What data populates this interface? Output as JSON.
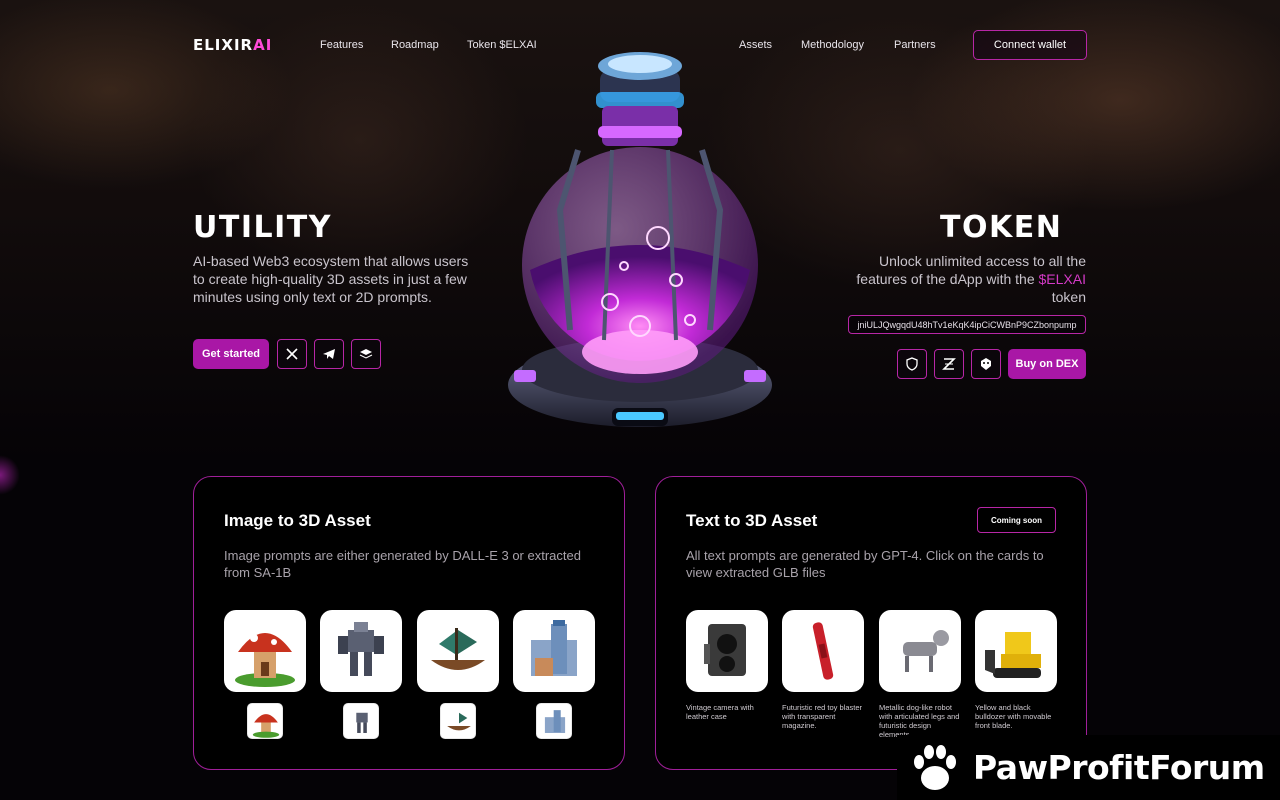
{
  "nav": {
    "logo_text": "ELIXIR",
    "logo_accent": "AI",
    "links_left": [
      "Features",
      "Roadmap",
      "Token $ELXAI"
    ],
    "links_right": [
      "Assets",
      "Methodology",
      "Partners"
    ],
    "connect_wallet": "Connect wallet"
  },
  "hero_left": {
    "title": "UTILITY",
    "description": "AI-based Web3 ecosystem that allows users to create high-quality 3D assets in just a few minutes using only text or 2D prompts.",
    "get_started": "Get started",
    "social_icons": [
      "x-icon",
      "telegram-icon",
      "docs-icon"
    ]
  },
  "hero_right": {
    "title": "TOKEN",
    "desc_before": "Unlock unlimited access to all the features of the dApp with the ",
    "desc_token": "$ELXAI",
    "desc_after": " token",
    "contract_address": "jniULJQwgqdU48hTv1eKqK4ipCiCWBnP9CZbonpump",
    "icons": [
      "shield-icon",
      "dexscreener-icon",
      "dextools-icon"
    ],
    "buy_label": "Buy on DEX"
  },
  "card_image": {
    "title": "Image to 3D Asset",
    "description": "Image prompts are either generated by DALL-E 3 or extracted from SA-1B",
    "items": [
      "mushroom-house",
      "mech-robot",
      "pirate-ship",
      "stone-castle"
    ]
  },
  "card_text": {
    "title": "Text to 3D Asset",
    "badge": "Coming soon",
    "description": "All text prompts are generated by GPT-4. Click on the cards to view extracted GLB files",
    "items": [
      {
        "icon": "camera",
        "caption": "Vintage camera with leather case"
      },
      {
        "icon": "blaster",
        "caption": "Futuristic red toy blaster with transparent magazine."
      },
      {
        "icon": "robot-dog",
        "caption": "Metallic dog-like robot with articulated legs and futuristic design elements."
      },
      {
        "icon": "bulldozer",
        "caption": "Yellow and black bulldozer with movable front blade."
      }
    ]
  },
  "watermark": {
    "text": "PawProfitForum"
  },
  "colors": {
    "accent": "#a917a6",
    "border": "#b726a6",
    "token": "#d43ac6"
  }
}
